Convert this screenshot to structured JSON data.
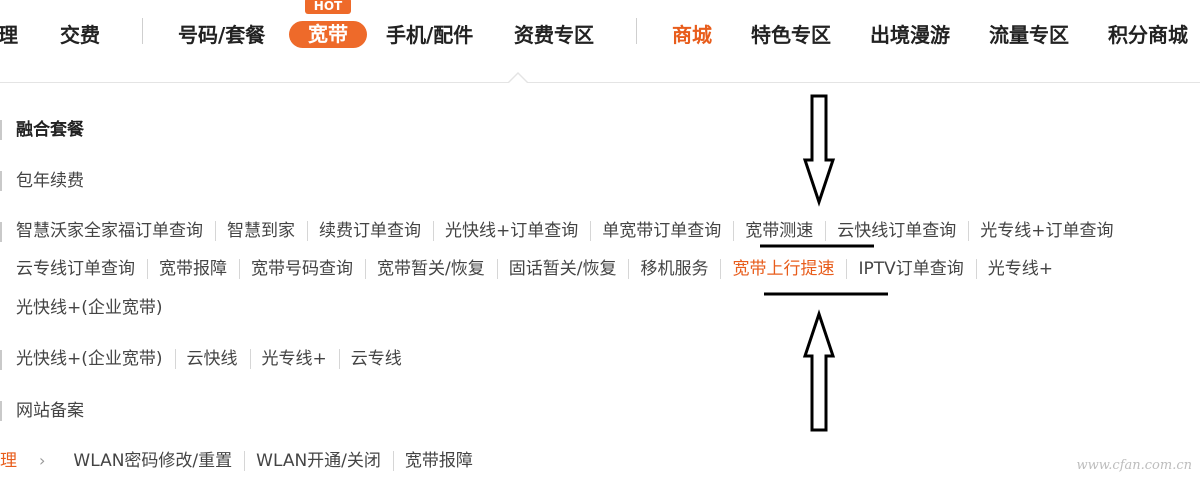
{
  "nav": {
    "items": [
      {
        "label": "办理"
      },
      {
        "label": "交费"
      },
      {
        "label": "号码/套餐"
      },
      {
        "label": "宽带",
        "badge": "HOT"
      },
      {
        "label": "手机/配件"
      },
      {
        "label": "资费专区"
      },
      {
        "label": "商城"
      },
      {
        "label": "特色专区"
      },
      {
        "label": "出境漫游"
      },
      {
        "label": "流量专区"
      },
      {
        "label": "积分商城"
      }
    ]
  },
  "sections": {
    "combo": "融合套餐",
    "renew": "包年续费",
    "services_row1": [
      "智慧沃家全家福订单查询",
      "智慧到家",
      "续费订单查询",
      "光快线+订单查询",
      "单宽带订单查询",
      "宽带测速",
      "云快线订单查询",
      "光专线+订单查询"
    ],
    "services_row2": [
      "云专线订单查询",
      "宽带报障",
      "宽带号码查询",
      "宽带暂关/恢复",
      "固话暂关/恢复",
      "移机服务",
      "宽带上行提速",
      "IPTV订单查询",
      "光专线+"
    ],
    "services_row3": [
      "光快线+(企业宽带)"
    ],
    "enterprise": [
      "光快线+(企业宽带)",
      "云快线",
      "光专线+",
      "云专线"
    ],
    "site": "网站备案",
    "wlan_prefix": "办理",
    "wlan": [
      "WLAN密码修改/重置",
      "WLAN开通/关闭",
      "宽带报障"
    ]
  },
  "watermark": "www.cfan.com.cn",
  "colors": {
    "accent": "#e85d1c",
    "pill": "#ee6a2a"
  }
}
